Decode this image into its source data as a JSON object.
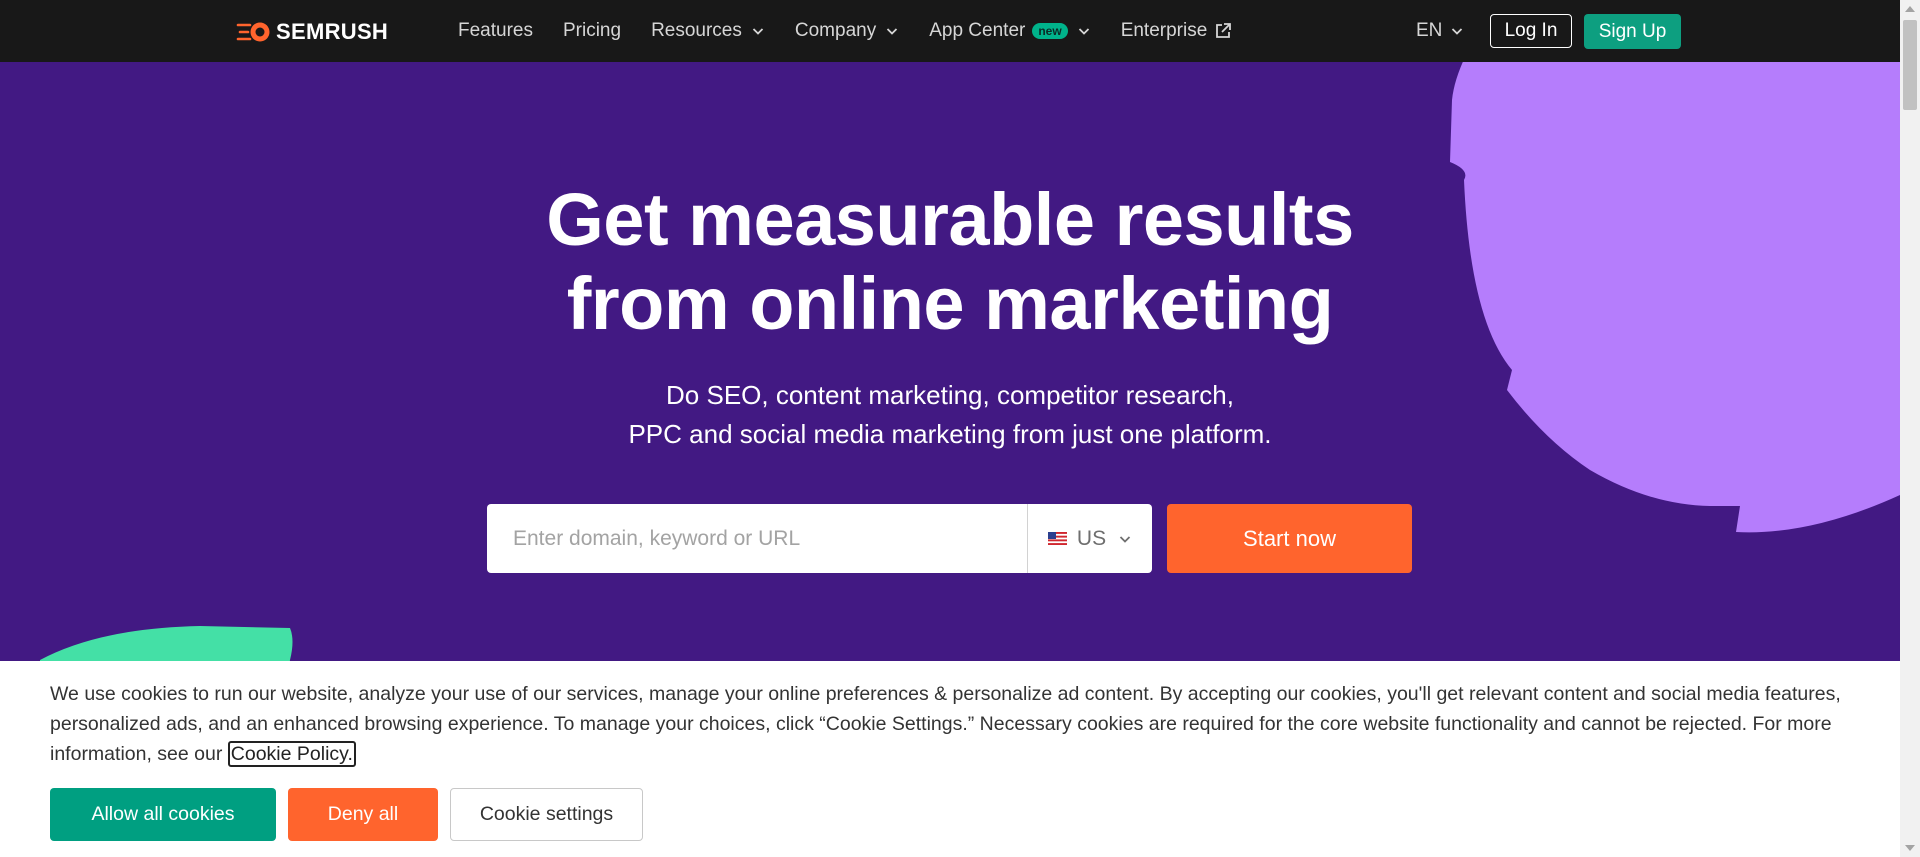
{
  "nav": {
    "logo_text": "SEMRUSH",
    "items": [
      {
        "label": "Features"
      },
      {
        "label": "Pricing"
      },
      {
        "label": "Resources"
      },
      {
        "label": "Company"
      },
      {
        "label": "App Center",
        "badge": "new"
      },
      {
        "label": "Enterprise"
      }
    ],
    "lang": "EN",
    "login_label": "Log In",
    "signup_label": "Sign Up"
  },
  "hero": {
    "title_line1": "Get measurable results",
    "title_line2": "from online marketing",
    "subtitle_line1": "Do SEO, content marketing, competitor research,",
    "subtitle_line2": "PPC and social media marketing from just one platform.",
    "search_placeholder": "Enter domain, keyword or URL",
    "database": "US",
    "cta_label": "Start now"
  },
  "cookie": {
    "text": "We use cookies to run our website, analyze your use of our services, manage your online preferences & personalize ad content. By accepting our cookies, you'll get relevant content and social media features, personalized ads, and an enhanced browsing experience. To manage your choices, click “Cookie Settings.” Necessary cookies are required for the core website functionality and cannot be rejected. For more information, see our",
    "link_label": "Cookie Policy.",
    "allow_label": "Allow all cookies",
    "deny_label": "Deny all",
    "settings_label": "Cookie settings"
  },
  "colors": {
    "hero_bg": "#421983",
    "nav_bg": "#181818",
    "accent_orange": "#ff642d",
    "accent_green": "#009f81",
    "deco_purple": "#b57dfc",
    "deco_green": "#44e0a6"
  },
  "icons": [
    "semrush-logo-icon",
    "chevron-down-icon",
    "external-link-icon",
    "us-flag-icon"
  ]
}
